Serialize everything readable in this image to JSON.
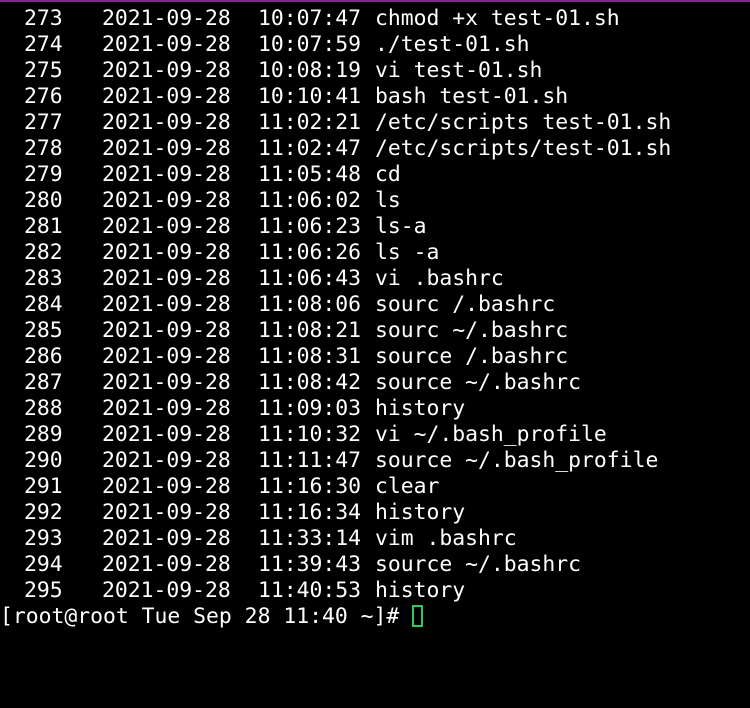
{
  "terminal": {
    "history": [
      {
        "num": "273",
        "date": "2021-09-28",
        "time": "10:07:47",
        "cmd": "chmod +x test-01.sh"
      },
      {
        "num": "274",
        "date": "2021-09-28",
        "time": "10:07:59",
        "cmd": "./test-01.sh"
      },
      {
        "num": "275",
        "date": "2021-09-28",
        "time": "10:08:19",
        "cmd": "vi test-01.sh"
      },
      {
        "num": "276",
        "date": "2021-09-28",
        "time": "10:10:41",
        "cmd": "bash test-01.sh"
      },
      {
        "num": "277",
        "date": "2021-09-28",
        "time": "11:02:21",
        "cmd": "/etc/scripts test-01.sh"
      },
      {
        "num": "278",
        "date": "2021-09-28",
        "time": "11:02:47",
        "cmd": "/etc/scripts/test-01.sh"
      },
      {
        "num": "279",
        "date": "2021-09-28",
        "time": "11:05:48",
        "cmd": "cd"
      },
      {
        "num": "280",
        "date": "2021-09-28",
        "time": "11:06:02",
        "cmd": "ls"
      },
      {
        "num": "281",
        "date": "2021-09-28",
        "time": "11:06:23",
        "cmd": "ls-a"
      },
      {
        "num": "282",
        "date": "2021-09-28",
        "time": "11:06:26",
        "cmd": "ls -a"
      },
      {
        "num": "283",
        "date": "2021-09-28",
        "time": "11:06:43",
        "cmd": "vi .bashrc"
      },
      {
        "num": "284",
        "date": "2021-09-28",
        "time": "11:08:06",
        "cmd": "sourc /.bashrc"
      },
      {
        "num": "285",
        "date": "2021-09-28",
        "time": "11:08:21",
        "cmd": "sourc ~/.bashrc"
      },
      {
        "num": "286",
        "date": "2021-09-28",
        "time": "11:08:31",
        "cmd": "source /.bashrc"
      },
      {
        "num": "287",
        "date": "2021-09-28",
        "time": "11:08:42",
        "cmd": "source ~/.bashrc"
      },
      {
        "num": "288",
        "date": "2021-09-28",
        "time": "11:09:03",
        "cmd": "history"
      },
      {
        "num": "289",
        "date": "2021-09-28",
        "time": "11:10:32",
        "cmd": "vi ~/.bash_profile"
      },
      {
        "num": "290",
        "date": "2021-09-28",
        "time": "11:11:47",
        "cmd": "source ~/.bash_profile"
      },
      {
        "num": "291",
        "date": "2021-09-28",
        "time": "11:16:30",
        "cmd": "clear"
      },
      {
        "num": "292",
        "date": "2021-09-28",
        "time": "11:16:34",
        "cmd": "history"
      },
      {
        "num": "293",
        "date": "2021-09-28",
        "time": "11:33:14",
        "cmd": "vim .bashrc"
      },
      {
        "num": "294",
        "date": "2021-09-28",
        "time": "11:39:43",
        "cmd": "source ~/.bashrc"
      },
      {
        "num": "295",
        "date": "2021-09-28",
        "time": "11:40:53",
        "cmd": "history"
      }
    ],
    "prompt": "[root@root Tue Sep 28 11:40 ~]# ",
    "colors": {
      "background": "#000000",
      "foreground": "#ffffff",
      "cursor": "#34c759",
      "top_border": "#7a2a8a"
    }
  }
}
